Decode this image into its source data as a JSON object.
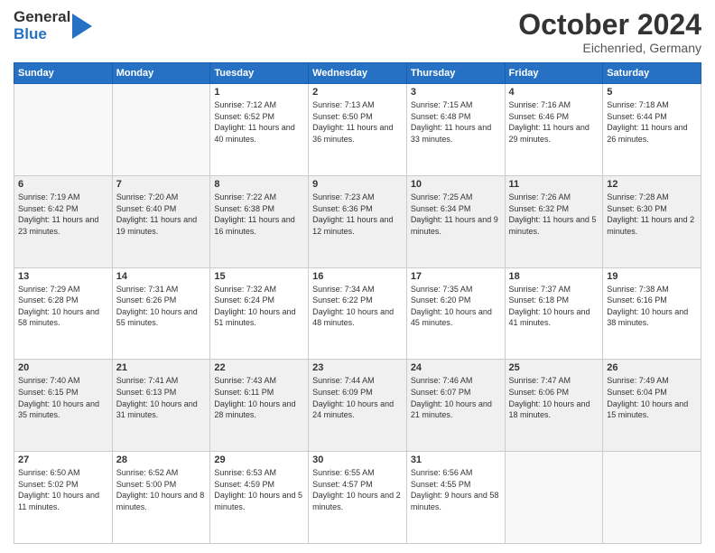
{
  "header": {
    "logo_line1": "General",
    "logo_line2": "Blue",
    "month": "October 2024",
    "location": "Eichenried, Germany"
  },
  "days_of_week": [
    "Sunday",
    "Monday",
    "Tuesday",
    "Wednesday",
    "Thursday",
    "Friday",
    "Saturday"
  ],
  "weeks": [
    [
      {
        "day": "",
        "info": ""
      },
      {
        "day": "",
        "info": ""
      },
      {
        "day": "1",
        "info": "Sunrise: 7:12 AM\nSunset: 6:52 PM\nDaylight: 11 hours and 40 minutes."
      },
      {
        "day": "2",
        "info": "Sunrise: 7:13 AM\nSunset: 6:50 PM\nDaylight: 11 hours and 36 minutes."
      },
      {
        "day": "3",
        "info": "Sunrise: 7:15 AM\nSunset: 6:48 PM\nDaylight: 11 hours and 33 minutes."
      },
      {
        "day": "4",
        "info": "Sunrise: 7:16 AM\nSunset: 6:46 PM\nDaylight: 11 hours and 29 minutes."
      },
      {
        "day": "5",
        "info": "Sunrise: 7:18 AM\nSunset: 6:44 PM\nDaylight: 11 hours and 26 minutes."
      }
    ],
    [
      {
        "day": "6",
        "info": "Sunrise: 7:19 AM\nSunset: 6:42 PM\nDaylight: 11 hours and 23 minutes."
      },
      {
        "day": "7",
        "info": "Sunrise: 7:20 AM\nSunset: 6:40 PM\nDaylight: 11 hours and 19 minutes."
      },
      {
        "day": "8",
        "info": "Sunrise: 7:22 AM\nSunset: 6:38 PM\nDaylight: 11 hours and 16 minutes."
      },
      {
        "day": "9",
        "info": "Sunrise: 7:23 AM\nSunset: 6:36 PM\nDaylight: 11 hours and 12 minutes."
      },
      {
        "day": "10",
        "info": "Sunrise: 7:25 AM\nSunset: 6:34 PM\nDaylight: 11 hours and 9 minutes."
      },
      {
        "day": "11",
        "info": "Sunrise: 7:26 AM\nSunset: 6:32 PM\nDaylight: 11 hours and 5 minutes."
      },
      {
        "day": "12",
        "info": "Sunrise: 7:28 AM\nSunset: 6:30 PM\nDaylight: 11 hours and 2 minutes."
      }
    ],
    [
      {
        "day": "13",
        "info": "Sunrise: 7:29 AM\nSunset: 6:28 PM\nDaylight: 10 hours and 58 minutes."
      },
      {
        "day": "14",
        "info": "Sunrise: 7:31 AM\nSunset: 6:26 PM\nDaylight: 10 hours and 55 minutes."
      },
      {
        "day": "15",
        "info": "Sunrise: 7:32 AM\nSunset: 6:24 PM\nDaylight: 10 hours and 51 minutes."
      },
      {
        "day": "16",
        "info": "Sunrise: 7:34 AM\nSunset: 6:22 PM\nDaylight: 10 hours and 48 minutes."
      },
      {
        "day": "17",
        "info": "Sunrise: 7:35 AM\nSunset: 6:20 PM\nDaylight: 10 hours and 45 minutes."
      },
      {
        "day": "18",
        "info": "Sunrise: 7:37 AM\nSunset: 6:18 PM\nDaylight: 10 hours and 41 minutes."
      },
      {
        "day": "19",
        "info": "Sunrise: 7:38 AM\nSunset: 6:16 PM\nDaylight: 10 hours and 38 minutes."
      }
    ],
    [
      {
        "day": "20",
        "info": "Sunrise: 7:40 AM\nSunset: 6:15 PM\nDaylight: 10 hours and 35 minutes."
      },
      {
        "day": "21",
        "info": "Sunrise: 7:41 AM\nSunset: 6:13 PM\nDaylight: 10 hours and 31 minutes."
      },
      {
        "day": "22",
        "info": "Sunrise: 7:43 AM\nSunset: 6:11 PM\nDaylight: 10 hours and 28 minutes."
      },
      {
        "day": "23",
        "info": "Sunrise: 7:44 AM\nSunset: 6:09 PM\nDaylight: 10 hours and 24 minutes."
      },
      {
        "day": "24",
        "info": "Sunrise: 7:46 AM\nSunset: 6:07 PM\nDaylight: 10 hours and 21 minutes."
      },
      {
        "day": "25",
        "info": "Sunrise: 7:47 AM\nSunset: 6:06 PM\nDaylight: 10 hours and 18 minutes."
      },
      {
        "day": "26",
        "info": "Sunrise: 7:49 AM\nSunset: 6:04 PM\nDaylight: 10 hours and 15 minutes."
      }
    ],
    [
      {
        "day": "27",
        "info": "Sunrise: 6:50 AM\nSunset: 5:02 PM\nDaylight: 10 hours and 11 minutes."
      },
      {
        "day": "28",
        "info": "Sunrise: 6:52 AM\nSunset: 5:00 PM\nDaylight: 10 hours and 8 minutes."
      },
      {
        "day": "29",
        "info": "Sunrise: 6:53 AM\nSunset: 4:59 PM\nDaylight: 10 hours and 5 minutes."
      },
      {
        "day": "30",
        "info": "Sunrise: 6:55 AM\nSunset: 4:57 PM\nDaylight: 10 hours and 2 minutes."
      },
      {
        "day": "31",
        "info": "Sunrise: 6:56 AM\nSunset: 4:55 PM\nDaylight: 9 hours and 58 minutes."
      },
      {
        "day": "",
        "info": ""
      },
      {
        "day": "",
        "info": ""
      }
    ]
  ]
}
